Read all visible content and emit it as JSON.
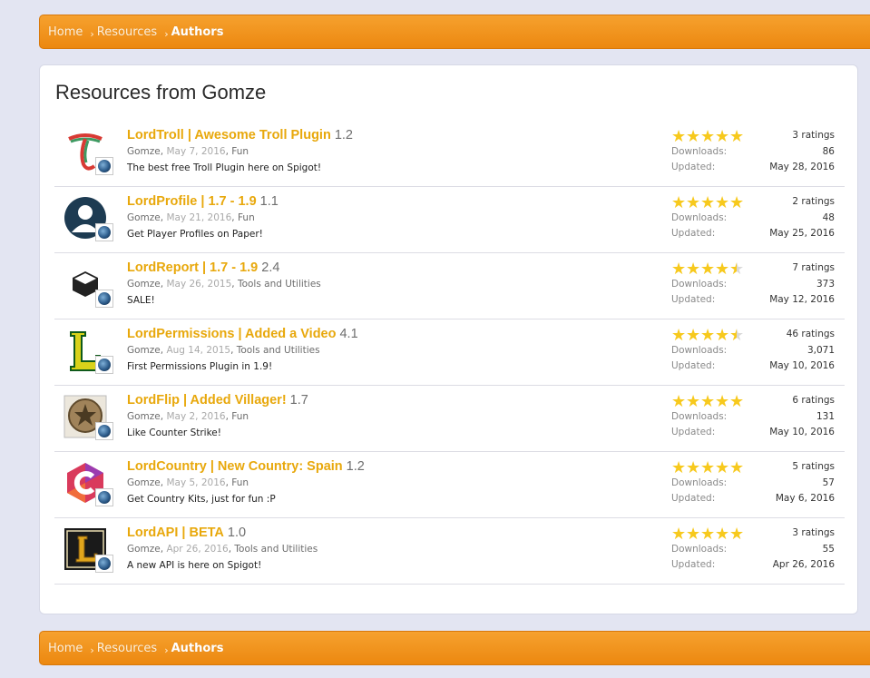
{
  "breadcrumb": [
    {
      "label": "Home"
    },
    {
      "label": "Resources"
    },
    {
      "label": "Authors"
    }
  ],
  "page_title": "Resources from Gomze",
  "stats_labels": {
    "downloads": "Downloads:",
    "updated": "Updated:"
  },
  "resources": [
    {
      "name": "LordTroll | Awesome Troll Plugin",
      "version": "1.2",
      "author": "Gomze",
      "date": "May 7, 2016",
      "category": "Fun",
      "description": "The best free Troll Plugin here on Spigot!",
      "rating": 5,
      "ratings": "3 ratings",
      "downloads": "86",
      "updated": "May 28, 2016",
      "icon": "troll-t-icon"
    },
    {
      "name": "LordProfile | 1.7 - 1.9",
      "version": "1.1",
      "author": "Gomze",
      "date": "May 21, 2016",
      "category": "Fun",
      "description": "Get Player Profiles on Paper!",
      "rating": 5,
      "ratings": "2 ratings",
      "downloads": "48",
      "updated": "May 25, 2016",
      "icon": "profile-person-icon"
    },
    {
      "name": "LordReport | 1.7 - 1.9",
      "version": "2.4",
      "author": "Gomze",
      "date": "May 26, 2015",
      "category": "Tools and Utilities",
      "description": "SALE!",
      "rating": 4.5,
      "ratings": "7 ratings",
      "downloads": "373",
      "updated": "May 12, 2016",
      "icon": "report-cube-icon"
    },
    {
      "name": "LordPermissions | Added a Video",
      "version": "4.1",
      "author": "Gomze",
      "date": "Aug 14, 2015",
      "category": "Tools and Utilities",
      "description": "First Permissions Plugin in 1.9!",
      "rating": 4.5,
      "ratings": "46 ratings",
      "downloads": "3,071",
      "updated": "May 10, 2016",
      "icon": "permissions-l-icon"
    },
    {
      "name": "LordFlip | Added Villager!",
      "version": "1.7",
      "author": "Gomze",
      "date": "May 2, 2016",
      "category": "Fun",
      "description": "Like Counter Strike!",
      "rating": 5,
      "ratings": "6 ratings",
      "downloads": "131",
      "updated": "May 10, 2016",
      "icon": "counter-strike-emblem-icon"
    },
    {
      "name": "LordCountry | New Country: Spain",
      "version": "1.2",
      "author": "Gomze",
      "date": "May 5, 2016",
      "category": "Fun",
      "description": "Get Country Kits, just for fun :P",
      "rating": 5,
      "ratings": "5 ratings",
      "downloads": "57",
      "updated": "May 6, 2016",
      "icon": "country-c-hexagon-icon"
    },
    {
      "name": "LordAPI | BETA",
      "version": "1.0",
      "author": "Gomze",
      "date": "Apr 26, 2016",
      "category": "Tools and Utilities",
      "description": "A new API is here on Spigot!",
      "rating": 5,
      "ratings": "3 ratings",
      "downloads": "55",
      "updated": "Apr 26, 2016",
      "icon": "api-ornate-l-icon"
    }
  ],
  "colors": {
    "accent_orange": "#ec8810",
    "title_gold": "#e8a80c",
    "star": "#f7c91d"
  }
}
